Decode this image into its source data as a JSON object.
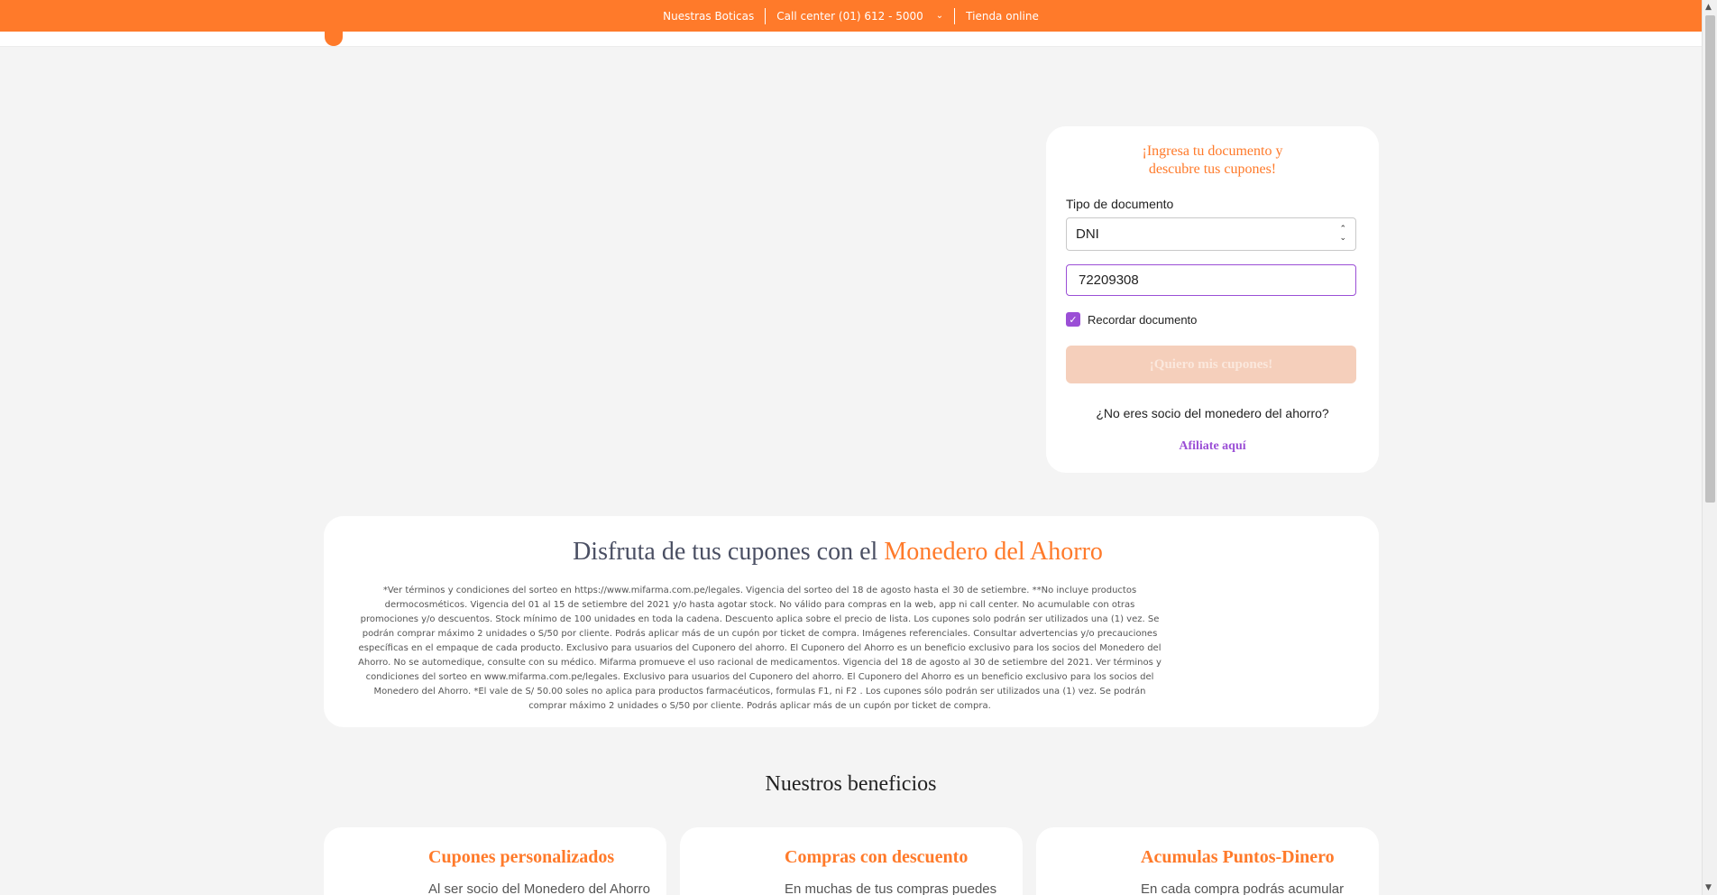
{
  "topbar": {
    "links": [
      "Nuestras Boticas",
      "Call center (01) 612 - 5000",
      "Tienda online"
    ],
    "chevron_icon": "chevron-down-icon"
  },
  "login": {
    "title_line1": "¡Ingresa tu documento y",
    "title_line2": "descubre tus cupones!",
    "doc_type_label": "Tipo de documento",
    "doc_type_value": "DNI",
    "doc_number_value": "72209308",
    "remember_label": "Recordar documento",
    "remember_checked": true,
    "submit_label": "¡Quiero mis cupones!",
    "not_member_text": "¿No eres socio del monedero del ahorro?",
    "affiliate_link": "Afiliate aquí"
  },
  "info": {
    "title_prefix": "Disfruta de tus cupones con el ",
    "title_accent": "Monedero del Ahorro",
    "legal_text": "*Ver términos y condiciones del sorteo en https://www.mifarma.com.pe/legales. Vigencia del sorteo del 18 de agosto hasta el 30 de setiembre. **No incluye productos dermocosméticos. Vigencia del 01 al 15 de setiembre del 2021 y/o hasta agotar stock. No válido para compras en la web, app ni call center. No acumulable con otras promociones y/o descuentos. Stock mínimo de 100 unidades en toda la cadena. Descuento aplica sobre el precio de lista. Los cupones solo podrán ser utilizados una (1) vez. Se podrán comprar máximo 2 unidades o S/50 por cliente. Podrás aplicar más de un cupón por ticket de compra. Imágenes referenciales. Consultar advertencias y/o precauciones específicas en el empaque de cada producto. Exclusivo para usuarios del Cuponero del ahorro. El Cuponero del Ahorro es un beneficio exclusivo para los socios del Monedero del Ahorro. No se automedique, consulte con su médico. Mifarma promueve el uso racional de medicamentos. Vigencia del 18 de agosto al 30 de setiembre del 2021. Ver términos y condiciones del sorteo en www.mifarma.com.pe/legales. Exclusivo para usuarios del Cuponero del ahorro. El Cuponero del Ahorro es un beneficio exclusivo para los socios del Monedero del Ahorro. *El vale de S/ 50.00 soles no aplica para productos farmacéuticos, formulas F1, ni F2 . Los cupones sólo podrán ser utilizados una (1) vez. Se podrán comprar máximo 2 unidades o S/50 por cliente. Podrás aplicar más de un cupón por ticket de compra."
  },
  "benefits": {
    "heading": "Nuestros beneficios",
    "items": [
      {
        "title": "Cupones personalizados",
        "desc": "Al ser socio del Monedero del Ahorro"
      },
      {
        "title": "Compras con descuento",
        "desc": "En muchas de tus compras puedes"
      },
      {
        "title": "Acumulas Puntos-Dinero",
        "desc": "En cada compra podrás acumular"
      }
    ]
  },
  "colors": {
    "brand": "#ff7a2a",
    "accent_purple": "#9b4fd6",
    "background": "#f4f4f4"
  }
}
